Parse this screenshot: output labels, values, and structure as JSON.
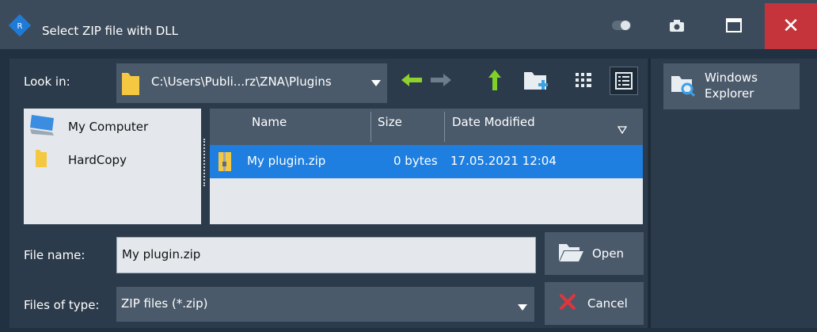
{
  "window": {
    "title": "Select ZIP file with DLL",
    "close_label": "✕"
  },
  "toolbar": {
    "look_in_label": "Look in:",
    "path": "C:\\Users\\Publi...rz\\ZNA\\Plugins"
  },
  "places": [
    {
      "label": "My Computer"
    },
    {
      "label": "HardCopy"
    }
  ],
  "files": {
    "columns": [
      "Name",
      "Size",
      "Date Modified"
    ],
    "rows": [
      {
        "name": "My plugin.zip",
        "size": "0 bytes",
        "date": "17.05.2021 12:04"
      }
    ]
  },
  "file_name": {
    "label": "File name:",
    "value": "My plugin.zip"
  },
  "file_type": {
    "label": "Files of type:",
    "value": "ZIP files (*.zip)"
  },
  "buttons": {
    "open": "Open",
    "cancel": "Cancel",
    "explorer": "Windows Explorer"
  },
  "colors": {
    "selection": "#1e7fe0",
    "close": "#c4343a",
    "back_arrow": "#8fd12e",
    "up_arrow": "#7fd12a"
  }
}
